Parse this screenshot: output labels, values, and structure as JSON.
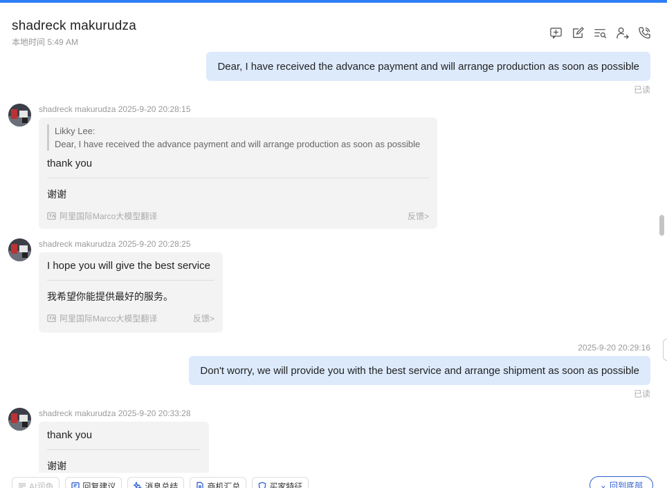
{
  "header": {
    "contact_name": "shadreck makurudza",
    "local_time": "本地时间 5:49 AM",
    "icons": [
      "add-comment-icon",
      "edit-icon",
      "search-list-icon",
      "transfer-user-icon",
      "phone-icon"
    ]
  },
  "messages": [
    {
      "direction": "out",
      "text": "Dear, I have received the advance payment and will arrange production as soon as possible",
      "status": "已读"
    },
    {
      "direction": "in",
      "sender": "shadreck makurudza",
      "timestamp": "2025-9-20 20:28:15",
      "quote_author": "Likky Lee:",
      "quote_text": "Dear, I have received the advance payment and will arrange production as soon as possible",
      "text": "thank you",
      "translation": "谢谢",
      "translator": "阿里国际Marco大模型翻译",
      "feedback": "反馈>"
    },
    {
      "direction": "in",
      "sender": "shadreck makurudza",
      "timestamp": "2025-9-20 20:28:25",
      "text": "I hope you will give the best service",
      "translation": "我希望你能提供最好的服务。",
      "translator": "阿里国际Marco大模型翻译",
      "feedback": "反馈>"
    },
    {
      "direction": "out",
      "timestamp": "2025-9-20 20:29:16",
      "text": "Don't worry, we will provide you with the best service and arrange shipment as soon as possible",
      "status": "已读"
    },
    {
      "direction": "in",
      "sender": "shadreck makurudza",
      "timestamp": "2025-9-20 20:33:28",
      "text": "thank you",
      "translation": "谢谢"
    }
  ],
  "toolbar": {
    "chips": [
      "AI润色",
      "回复建议",
      "消息总结",
      "商机汇总",
      "买家特征"
    ],
    "back_to_bottom": "回到底部"
  }
}
